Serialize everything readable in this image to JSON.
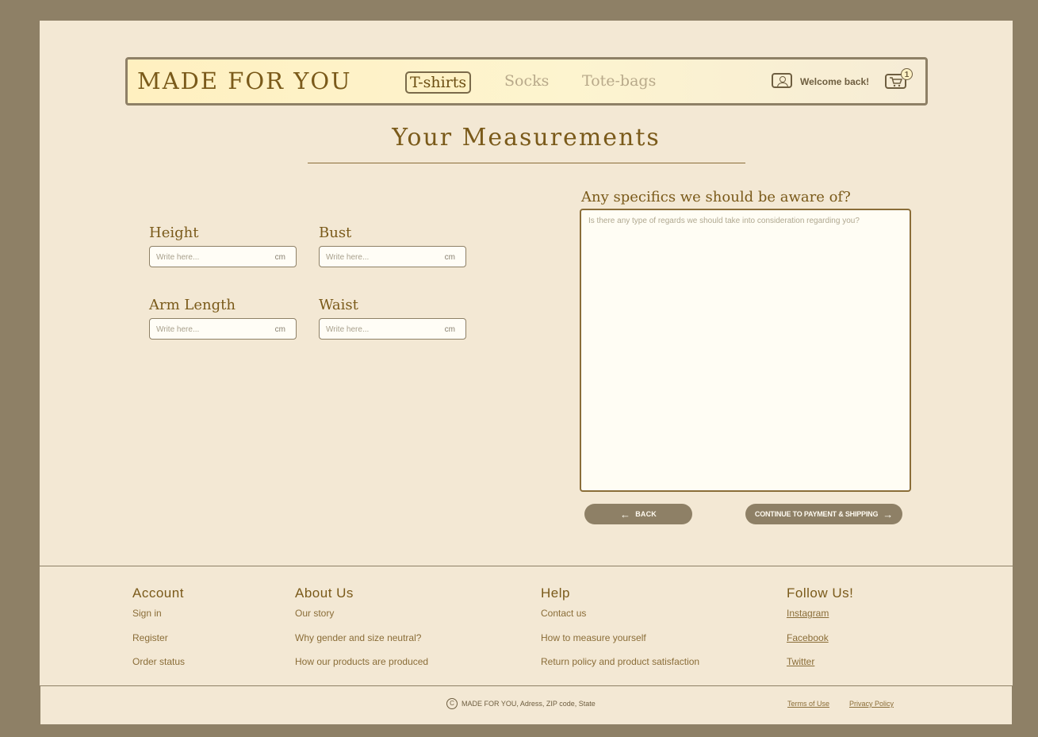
{
  "header": {
    "logo": "MADE FOR YOU",
    "nav": [
      {
        "label": "T-shirts",
        "active": true
      },
      {
        "label": "Socks",
        "active": false
      },
      {
        "label": "Tote-bags",
        "active": false
      }
    ],
    "welcome": "Welcome back!",
    "cart_count": "1",
    "user_icon": "user-icon",
    "cart_icon": "cart-icon"
  },
  "page": {
    "title": "Your Measurements"
  },
  "fields": {
    "height": {
      "label": "Height",
      "placeholder": "Write here...",
      "unit": "cm",
      "value": ""
    },
    "bust": {
      "label": "Bust",
      "placeholder": "Write here...",
      "unit": "cm",
      "value": ""
    },
    "arm_length": {
      "label": "Arm Length",
      "placeholder": "Write here...",
      "unit": "cm",
      "value": ""
    },
    "waist": {
      "label": "Waist",
      "placeholder": "Write here...",
      "unit": "cm",
      "value": ""
    }
  },
  "specifics": {
    "label": "Any specifics we should be aware of?",
    "placeholder": "Is there any type of regards we should take into consideration regarding you?",
    "value": ""
  },
  "buttons": {
    "back": "BACK",
    "continue": "CONTINUE TO PAYMENT & SHIPPING"
  },
  "footer": {
    "account": {
      "heading": "Account",
      "links": [
        "Sign in",
        "Register",
        "Order status"
      ]
    },
    "about": {
      "heading": "About Us",
      "links": [
        "Our story",
        "Why gender and size neutral?",
        "How our products are produced"
      ]
    },
    "help": {
      "heading": "Help",
      "links": [
        "Contact us",
        "How to measure yourself",
        "Return policy and product satisfaction"
      ]
    },
    "follow": {
      "heading": "Follow Us!",
      "links": [
        "Instagram",
        "Facebook",
        "Twitter"
      ]
    },
    "copyright_symbol": "C",
    "copyright": "MADE FOR YOU, Adress, ZIP code, State",
    "terms": "Terms of Use",
    "privacy": "Privacy Policy"
  },
  "colors": {
    "frame": "#8e8066",
    "page_bg": "#f3e8d4",
    "accent": "#7a5a1a",
    "button_bg": "#8e8066"
  }
}
